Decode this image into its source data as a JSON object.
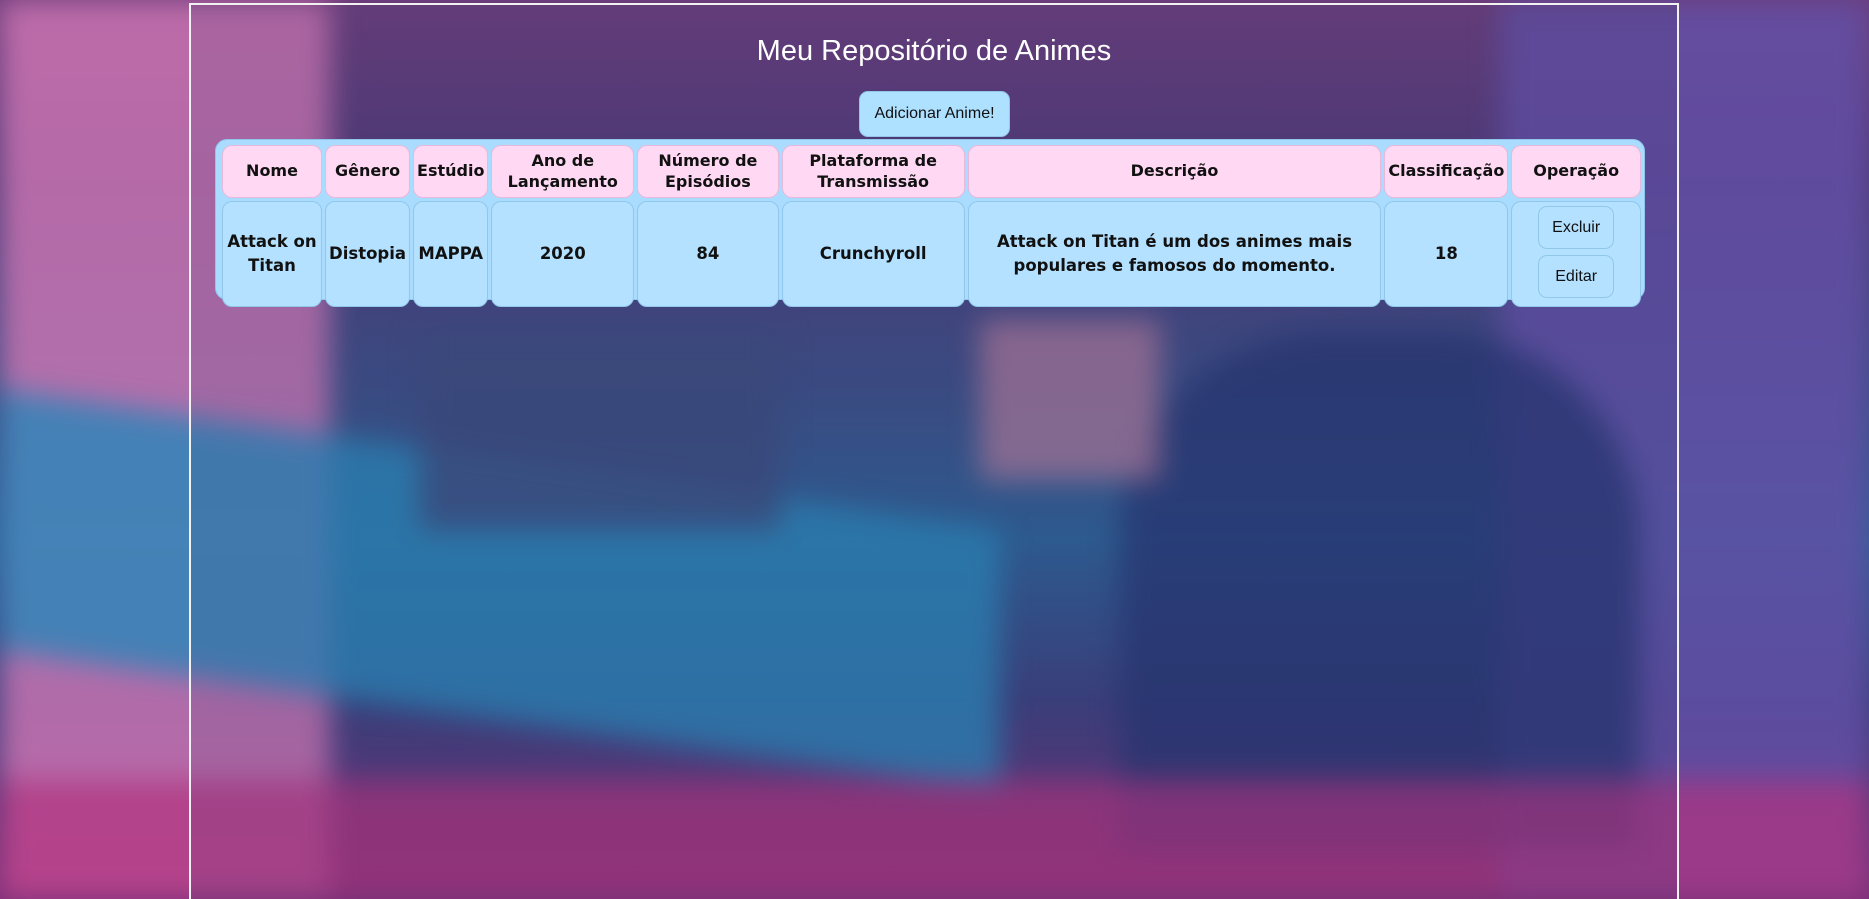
{
  "page": {
    "title": "Meu Repositório de Animes",
    "add_button_label": "Adicionar Anime!"
  },
  "table": {
    "headers": [
      "Nome",
      "Gênero",
      "Estúdio",
      "Ano de Lançamento",
      "Número de Episódios",
      "Plataforma de Transmissão",
      "Descrição",
      "Classificação",
      "Operação"
    ],
    "rows": [
      {
        "nome": "Attack on Titan",
        "genero": "Distopia",
        "estudio": "MAPPA",
        "ano": "2020",
        "episodios": "84",
        "plataforma": "Crunchyroll",
        "descricao": "Attack on Titan é um dos animes mais populares e famosos do momento.",
        "classificacao": "18",
        "excluir_label": "Excluir",
        "editar_label": "Editar"
      }
    ]
  },
  "colors": {
    "header_cell": "#ffd9f3",
    "body_cell": "#b3e1ff",
    "table_bg": "#a9dcff",
    "frame_border": "#f2f2f2"
  }
}
